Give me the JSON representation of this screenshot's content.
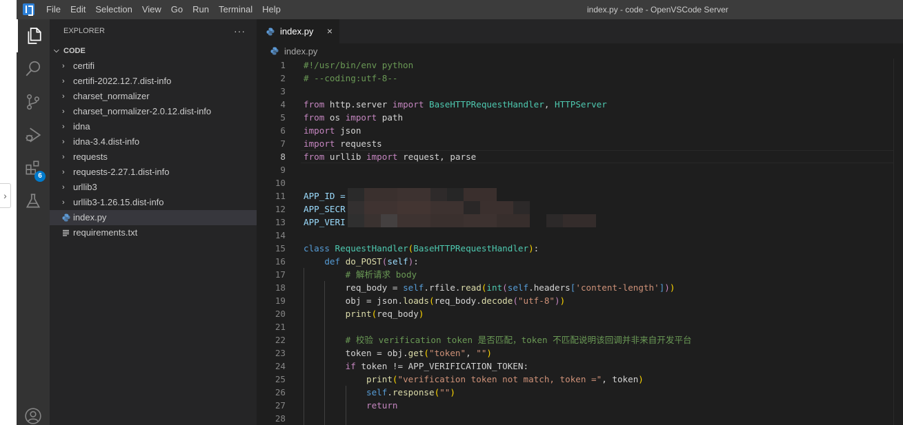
{
  "titlebar": {
    "menu": [
      "File",
      "Edit",
      "Selection",
      "View",
      "Go",
      "Run",
      "Terminal",
      "Help"
    ],
    "window_title": "index.py - code - OpenVSCode Server"
  },
  "activitybar": {
    "items": [
      {
        "icon": "files-icon",
        "active": true
      },
      {
        "icon": "search-icon",
        "active": false
      },
      {
        "icon": "source-control-icon",
        "active": false
      },
      {
        "icon": "run-debug-icon",
        "active": false
      },
      {
        "icon": "extensions-icon",
        "active": false,
        "badge": "6"
      },
      {
        "icon": "testing-flask-icon",
        "active": false
      }
    ],
    "bottom": {
      "icon": "account-icon"
    }
  },
  "sidebar": {
    "title": "EXPLORER",
    "more": "···",
    "section": "CODE",
    "items": [
      {
        "label": "certifi",
        "type": "folder"
      },
      {
        "label": "certifi-2022.12.7.dist-info",
        "type": "folder"
      },
      {
        "label": "charset_normalizer",
        "type": "folder"
      },
      {
        "label": "charset_normalizer-2.0.12.dist-info",
        "type": "folder"
      },
      {
        "label": "idna",
        "type": "folder"
      },
      {
        "label": "idna-3.4.dist-info",
        "type": "folder"
      },
      {
        "label": "requests",
        "type": "folder"
      },
      {
        "label": "requests-2.27.1.dist-info",
        "type": "folder"
      },
      {
        "label": "urllib3",
        "type": "folder"
      },
      {
        "label": "urllib3-1.26.15.dist-info",
        "type": "folder"
      },
      {
        "label": "index.py",
        "type": "python",
        "selected": true
      },
      {
        "label": "requirements.txt",
        "type": "text"
      }
    ]
  },
  "editor": {
    "tab": {
      "label": "index.py",
      "close": "×"
    },
    "breadcrumb": "index.py",
    "active_line": 8,
    "line_numbers": [
      "1",
      "2",
      "3",
      "4",
      "5",
      "6",
      "7",
      "8",
      "9",
      "10",
      "11",
      "12",
      "13",
      "14",
      "15",
      "16",
      "17",
      "18",
      "19",
      "20",
      "21",
      "22",
      "23",
      "24",
      "25",
      "26",
      "27",
      "28"
    ],
    "code_text": {
      "l1": "#!/usr/bin/env python",
      "l2": "# --coding:utf-8--",
      "l11": "APP_ID = ",
      "l12": "APP_SECR",
      "l13": "APP_VERI",
      "l17": "# 解析请求 body",
      "l22": "# 校验 verification token 是否匹配，token 不匹配说明该回调并非来自开发平台",
      "s18": "'content-length'",
      "s19": "\"utf-8\"",
      "s23a": "\"token\"",
      "s23b": "\"\"",
      "s25": "\"verification token not match, token =\"",
      "s26": "\"\""
    },
    "colors": {
      "keyword": "#569cd6",
      "control": "#c586c0",
      "comment": "#6a9955",
      "string": "#ce9178",
      "function": "#dcdcaa",
      "class": "#4ec9b0",
      "bracket": "#ffd700"
    }
  }
}
